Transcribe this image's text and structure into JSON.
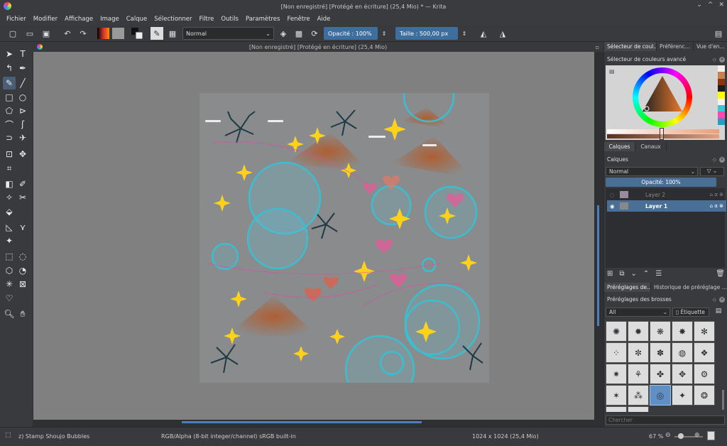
{
  "window": {
    "title": "[Non enregistré]  [Protégé en écriture]  (25,4 Mio) * — Krita",
    "buttons": [
      "⌄",
      "^",
      "✕"
    ]
  },
  "menu": [
    "Fichier",
    "Modifier",
    "Affichage",
    "Image",
    "Calque",
    "Sélectionner",
    "Filtre",
    "Outils",
    "Paramètres",
    "Fenêtre",
    "Aide"
  ],
  "toolbar": {
    "blend_mode": "Normal",
    "opacity_label": "Opacité :  100%",
    "size_label": "Taille :  500,00 px"
  },
  "document_tab": "[Non enregistré]  [Protégé en écriture]  (25,4 Mio)",
  "docker": {
    "top_tabs": [
      "Sélecteur de coul...",
      "Préférenc...",
      "Vue d'en..."
    ],
    "color_selector_title": "Sélecteur de couleurs avancé",
    "color_history": [
      "#f4f0ee",
      "#c8824e",
      "#8a3510",
      "#1d1d1d",
      "#ffff00",
      "#f2f2f2",
      "#35c9d8",
      "#ff46b6",
      "#22a0c4"
    ],
    "mid_tabs": [
      "Calques",
      "Canaux"
    ],
    "layers_title": "Calques",
    "blend_mode": "Normal",
    "opacity": "Opacité:  100%",
    "layers": [
      {
        "name": "Layer 2",
        "active": false
      },
      {
        "name": "Layer 1",
        "active": true
      }
    ],
    "bottom_tabs": [
      "Préréglages de...",
      "Historique de préréglage ..."
    ],
    "presets_title": "Préréglages des brosses",
    "preset_filter": "All",
    "tag_button": "Étiquette",
    "search_placeholder": "Chercher"
  },
  "status": {
    "preset": "z) Stamp Shoujo Bubbles",
    "colorspace": "RGB/Alpha (8-bit integer/channel)  sRGB built-in",
    "dimensions": "1024 x 1024 (25,4 Mio)",
    "zoom": "67 %"
  }
}
